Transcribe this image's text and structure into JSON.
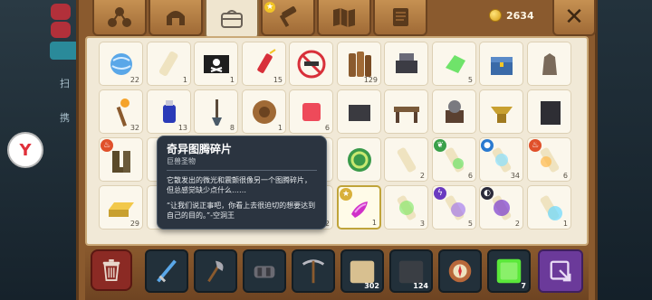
{
  "background": {
    "left_labels": [
      "扫",
      "携"
    ],
    "logo_text": "Y"
  },
  "tabs": [
    {
      "name": "tab-crafting",
      "icon": "crafting-nodes-icon"
    },
    {
      "name": "tab-equipment",
      "icon": "helmet-icon"
    },
    {
      "name": "tab-inventory",
      "icon": "backpack-icon",
      "active": true
    },
    {
      "name": "tab-quests",
      "icon": "hammer-icon",
      "badge": "star-badge-icon"
    },
    {
      "name": "tab-map",
      "icon": "map-icon"
    },
    {
      "name": "tab-scroll",
      "icon": "scroll-icon"
    }
  ],
  "currency": {
    "icon": "gold-coin-icon",
    "amount": "2634"
  },
  "close_button": {
    "icon": "close-x-icon"
  },
  "inventory": {
    "rows": [
      [
        {
          "item": "blue-orb",
          "count": "22"
        },
        {
          "item": "paper-scroll",
          "count": "1"
        },
        {
          "item": "pirate-flag",
          "count": "1"
        },
        {
          "item": "firework-rocket",
          "count": "15"
        },
        {
          "item": "no-guns-sign",
          "count": ""
        },
        {
          "item": "wood-logs",
          "count": "129"
        },
        {
          "item": "anvil-machine",
          "count": ""
        },
        {
          "item": "green-crystal",
          "count": "5"
        },
        {
          "item": "blue-chest",
          "count": ""
        },
        {
          "item": "stone-statue",
          "count": ""
        }
      ],
      [
        {
          "item": "torch",
          "count": "32"
        },
        {
          "item": "blue-potion",
          "count": "13"
        },
        {
          "item": "shovel",
          "count": "8"
        },
        {
          "item": "wooden-shield",
          "count": "1"
        },
        {
          "item": "red-gem",
          "count": "6"
        },
        {
          "item": "dark-crate",
          "count": ""
        },
        {
          "item": "workbench",
          "count": ""
        },
        {
          "item": "grindstone",
          "count": ""
        },
        {
          "item": "golden-anvil",
          "count": ""
        },
        {
          "item": "black-cabinet",
          "count": ""
        }
      ],
      [
        {
          "item": "leather-boots",
          "count": "",
          "element": "fire"
        },
        {
          "item": "hidden",
          "count": ""
        },
        {
          "item": "hidden",
          "count": ""
        },
        {
          "item": "hidden",
          "count": ""
        },
        {
          "item": "hidden",
          "count": ""
        },
        {
          "item": "green-serpent-coil",
          "count": ""
        },
        {
          "item": "rolled-scroll",
          "count": "2"
        },
        {
          "item": "nature-scroll",
          "count": "6",
          "element": "nature"
        },
        {
          "item": "water-scroll",
          "count": "34",
          "element": "water"
        },
        {
          "item": "fire-scroll",
          "count": "6",
          "element": "fire"
        }
      ],
      [
        {
          "item": "gold-bar",
          "count": "29"
        },
        {
          "item": "hidden",
          "count": ""
        },
        {
          "item": "hidden",
          "count": ""
        },
        {
          "item": "hidden",
          "count": ""
        },
        {
          "item": "hidden",
          "count": "2"
        },
        {
          "item": "purple-totem-fragment",
          "count": "1",
          "selected": true,
          "element": "star"
        },
        {
          "item": "green-glow-scroll",
          "count": "3"
        },
        {
          "item": "lightning-scroll",
          "count": "5",
          "element": "lightning"
        },
        {
          "item": "dark-scroll",
          "count": "2",
          "element": "dark"
        },
        {
          "item": "ice-scroll",
          "count": "1"
        }
      ]
    ]
  },
  "tooltip": {
    "title": "奇异图腾碎片",
    "category": "巨兽圣物",
    "description": "它散发出的微光和震颤很像另一个图腾碎片，但总感觉缺少点什么……",
    "quote": "“让我们说正事吧，你看上去很迫切的想要达到自己的目的。”-空洞王"
  },
  "hotbar": {
    "trash_icon": "trash-can-icon",
    "slots": [
      {
        "item": "blue-sword",
        "count": ""
      },
      {
        "item": "iron-axe",
        "count": ""
      },
      {
        "item": "mechanical-gauntlet",
        "count": ""
      },
      {
        "item": "pickaxe",
        "count": ""
      },
      {
        "item": "sandstone-block",
        "count": "302"
      },
      {
        "item": "dark-stone-block",
        "count": "124"
      },
      {
        "item": "compass",
        "count": ""
      },
      {
        "item": "green-slime-block",
        "count": "7"
      }
    ],
    "exit_icon": "exit-arrow-icon"
  },
  "colors": {
    "frame": "#8a5a2e",
    "panel": "#f1e9d7",
    "tooltip_bg": "#2b3440",
    "selected_border": "#c0a43a",
    "exit_button": "#6b3a9a",
    "trash_button": "#8b2a24"
  }
}
